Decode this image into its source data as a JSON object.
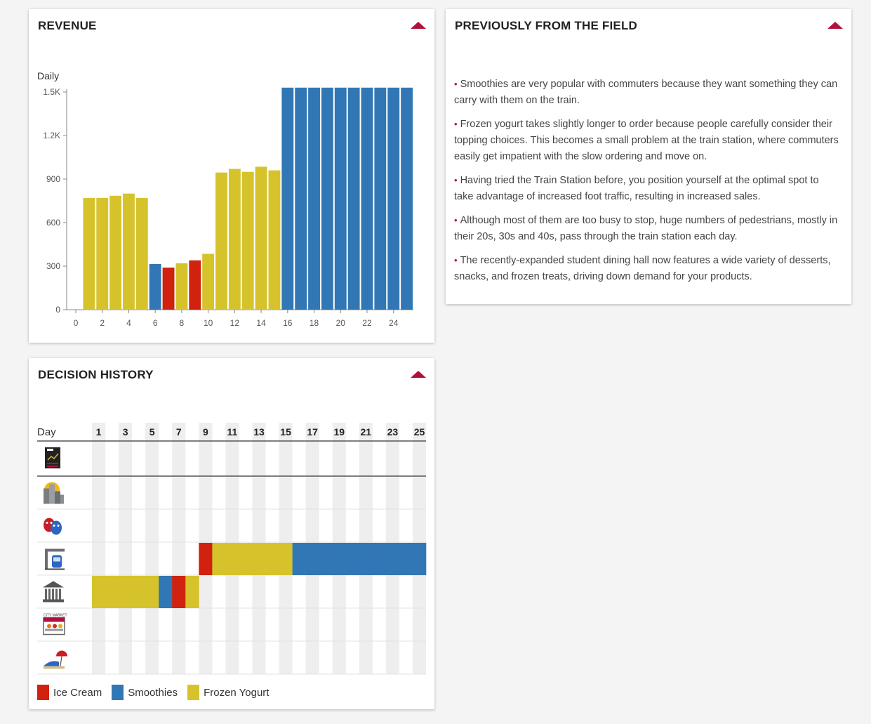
{
  "colors": {
    "ice_cream": "#d0220e",
    "smoothies": "#3277b5",
    "frozen_yogurt": "#d6c32b",
    "accent": "#b0113c"
  },
  "revenue": {
    "title": "REVENUE",
    "collapse_icon": "triangle-up-icon"
  },
  "chart_data": {
    "type": "bar",
    "title": "REVENUE",
    "ylabel": "Daily",
    "xlabel": "",
    "ylim": [
      0,
      1500
    ],
    "xlim": [
      0,
      25
    ],
    "yticks": [
      0,
      300,
      600,
      900,
      1200,
      1500
    ],
    "ytick_labels": [
      "0",
      "300",
      "600",
      "900",
      "1.2K",
      "1.5K"
    ],
    "xticks": [
      0,
      2,
      4,
      6,
      8,
      10,
      12,
      14,
      16,
      18,
      20,
      22,
      24
    ],
    "grid": false,
    "bars": [
      {
        "x": 1,
        "value": 770,
        "product": "frozen_yogurt"
      },
      {
        "x": 2,
        "value": 770,
        "product": "frozen_yogurt"
      },
      {
        "x": 3,
        "value": 785,
        "product": "frozen_yogurt"
      },
      {
        "x": 4,
        "value": 800,
        "product": "frozen_yogurt"
      },
      {
        "x": 5,
        "value": 770,
        "product": "frozen_yogurt"
      },
      {
        "x": 6,
        "value": 315,
        "product": "smoothies"
      },
      {
        "x": 7,
        "value": 290,
        "product": "ice_cream"
      },
      {
        "x": 8,
        "value": 320,
        "product": "frozen_yogurt"
      },
      {
        "x": 9,
        "value": 340,
        "product": "ice_cream"
      },
      {
        "x": 10,
        "value": 385,
        "product": "frozen_yogurt"
      },
      {
        "x": 11,
        "value": 945,
        "product": "frozen_yogurt"
      },
      {
        "x": 12,
        "value": 970,
        "product": "frozen_yogurt"
      },
      {
        "x": 13,
        "value": 950,
        "product": "frozen_yogurt"
      },
      {
        "x": 14,
        "value": 985,
        "product": "frozen_yogurt"
      },
      {
        "x": 15,
        "value": 960,
        "product": "frozen_yogurt"
      },
      {
        "x": 16,
        "value": 1530,
        "product": "smoothies"
      },
      {
        "x": 17,
        "value": 1530,
        "product": "smoothies"
      },
      {
        "x": 18,
        "value": 1530,
        "product": "smoothies"
      },
      {
        "x": 19,
        "value": 1530,
        "product": "smoothies"
      },
      {
        "x": 20,
        "value": 1530,
        "product": "smoothies"
      },
      {
        "x": 21,
        "value": 1530,
        "product": "smoothies"
      },
      {
        "x": 22,
        "value": 1530,
        "product": "smoothies"
      },
      {
        "x": 23,
        "value": 1530,
        "product": "smoothies"
      },
      {
        "x": 24,
        "value": 1530,
        "product": "smoothies"
      },
      {
        "x": 25,
        "value": 1530,
        "product": "smoothies"
      }
    ]
  },
  "field": {
    "title": "PREVIOUSLY FROM THE FIELD",
    "collapse_icon": "triangle-up-icon",
    "bullet": "•",
    "notes": [
      "Smoothies are very popular with commuters because they want something they can carry with them on the train.",
      "Frozen yogurt takes slightly longer to order because people carefully consider their topping choices. This becomes a small problem at the train station, where commuters easily get impatient with the slow ordering and move on.",
      "Having tried the Train Station before, you position yourself at the optimal spot to take advantage of increased foot traffic, resulting in increased sales.",
      "Although most of them are too busy to stop, huge numbers of pedestrians, mostly in their 20s, 30s and 40s, pass through the train station each day.",
      "The recently-expanded student dining hall now features a wide variety of desserts, snacks, and frozen treats, driving down demand for your products."
    ]
  },
  "history": {
    "title": "DECISION HISTORY",
    "collapse_icon": "triangle-up-icon",
    "day_word": "Day",
    "day_labels": [
      "1",
      "3",
      "5",
      "7",
      "9",
      "11",
      "13",
      "15",
      "17",
      "19",
      "21",
      "23",
      "25"
    ],
    "total_days": 25,
    "rows": [
      {
        "icon": "data-report-icon",
        "decisions": []
      },
      {
        "icon": "downtown-city-icon",
        "decisions": []
      },
      {
        "icon": "theater-masks-icon",
        "decisions": []
      },
      {
        "icon": "train-station-icon",
        "decisions": [
          {
            "day": 9,
            "product": "ice_cream"
          },
          {
            "day": 10,
            "product": "frozen_yogurt"
          },
          {
            "day": 11,
            "product": "frozen_yogurt"
          },
          {
            "day": 12,
            "product": "frozen_yogurt"
          },
          {
            "day": 13,
            "product": "frozen_yogurt"
          },
          {
            "day": 14,
            "product": "frozen_yogurt"
          },
          {
            "day": 15,
            "product": "frozen_yogurt"
          },
          {
            "day": 16,
            "product": "smoothies"
          },
          {
            "day": 17,
            "product": "smoothies"
          },
          {
            "day": 18,
            "product": "smoothies"
          },
          {
            "day": 19,
            "product": "smoothies"
          },
          {
            "day": 20,
            "product": "smoothies"
          },
          {
            "day": 21,
            "product": "smoothies"
          },
          {
            "day": 22,
            "product": "smoothies"
          },
          {
            "day": 23,
            "product": "smoothies"
          },
          {
            "day": 24,
            "product": "smoothies"
          },
          {
            "day": 25,
            "product": "smoothies"
          }
        ]
      },
      {
        "icon": "university-building-icon",
        "decisions": [
          {
            "day": 1,
            "product": "frozen_yogurt"
          },
          {
            "day": 2,
            "product": "frozen_yogurt"
          },
          {
            "day": 3,
            "product": "frozen_yogurt"
          },
          {
            "day": 4,
            "product": "frozen_yogurt"
          },
          {
            "day": 5,
            "product": "frozen_yogurt"
          },
          {
            "day": 6,
            "product": "smoothies"
          },
          {
            "day": 7,
            "product": "ice_cream"
          },
          {
            "day": 8,
            "product": "frozen_yogurt"
          }
        ]
      },
      {
        "icon": "city-market-icon",
        "sign_text": "CITY MARKET",
        "decisions": []
      },
      {
        "icon": "beach-umbrella-icon",
        "decisions": []
      }
    ],
    "legend": [
      {
        "label": "Ice Cream",
        "product": "ice_cream"
      },
      {
        "label": "Smoothies",
        "product": "smoothies"
      },
      {
        "label": "Frozen Yogurt",
        "product": "frozen_yogurt"
      }
    ]
  }
}
